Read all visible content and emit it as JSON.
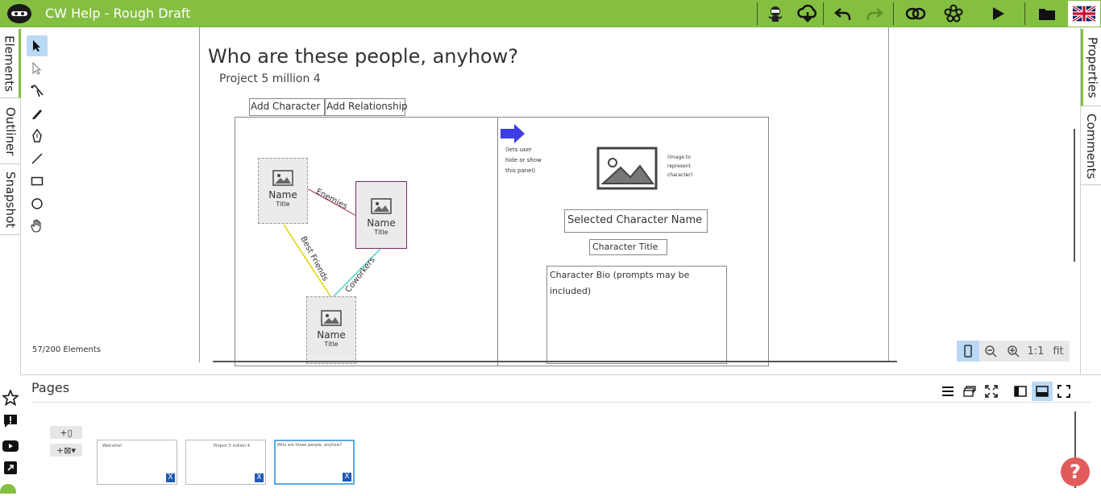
{
  "app": {
    "title": "CW Help - Rough Draft"
  },
  "colors": {
    "accent": "#84bf41",
    "selection": "#b9d9f5",
    "help": "#e25b5b"
  },
  "toolbar": {
    "icons": [
      "ninja-icon",
      "cloud-sync-icon",
      "undo-icon",
      "redo-icon",
      "link-icon",
      "group-icon",
      "play-icon",
      "folder-icon",
      "uk-flag-icon"
    ]
  },
  "left_tabs": [
    "Elements",
    "Outliner",
    "Snapshot"
  ],
  "right_tabs": [
    "Properties",
    "Comments"
  ],
  "tools": [
    "select-tool",
    "direct-select-tool",
    "pen-tool",
    "pencil-tool",
    "marker-tool",
    "line-tool",
    "rectangle-tool",
    "ellipse-tool",
    "hand-tool"
  ],
  "canvas": {
    "heading": "Who are these people, anyhow?",
    "subheading": "Project 5 million 4",
    "btn_add_character": "Add Character",
    "btn_add_relationship": "Add Relationship",
    "nodes": [
      {
        "name": "Name",
        "title": "Title"
      },
      {
        "name": "Name",
        "title": "Title"
      },
      {
        "name": "Name",
        "title": "Title"
      }
    ],
    "edges": [
      "Enemies",
      "Best Friends",
      "Coworkers"
    ],
    "arrow_note": "(lets user hide or show this panel)",
    "image_note": "(image to represent character)",
    "selected_name": "Selected Character Name",
    "character_title": "Character Title",
    "character_bio": "Character Bio (prompts may be included)",
    "element_count": "57/200 Elements"
  },
  "zoom": {
    "labels": [
      "1:1",
      "fit"
    ]
  },
  "pages": {
    "title": "Pages",
    "add_page": "+▯",
    "add_template": "+⊠▾",
    "thumbnails": [
      {
        "label": "Welcome!"
      },
      {
        "label": "Project 5 million 4"
      },
      {
        "label": "Who are these people, anyhow?"
      }
    ]
  },
  "help": {
    "label": "?"
  }
}
